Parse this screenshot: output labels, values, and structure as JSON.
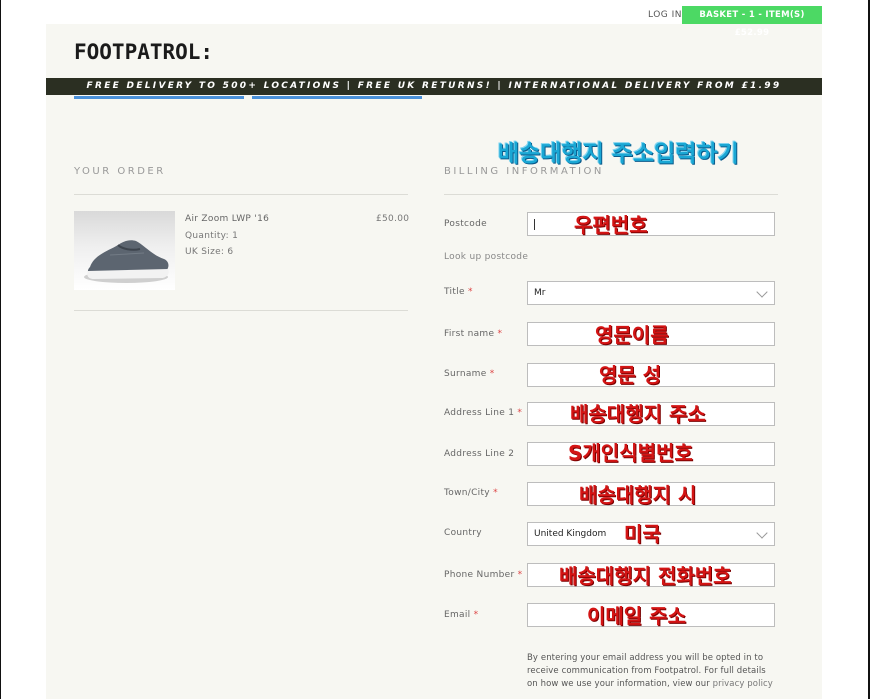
{
  "header": {
    "login_label": "LOG IN",
    "basket_label": "BASKET - 1 - ITEM(S) £52.99",
    "logo_text": "FOOTPATROL:",
    "delivery_banner": "FREE DELIVERY TO 500+ LOCATIONS | FREE UK RETURNS! | INTERNATIONAL DELIVERY FROM £1.99"
  },
  "order": {
    "heading": "YOUR ORDER",
    "product_name": "Air Zoom LWP '16",
    "quantity": "Quantity: 1",
    "size": "UK Size: 6",
    "price": "£50.00"
  },
  "billing": {
    "heading": "BILLING INFORMATION",
    "lookup_label": "Look up postcode",
    "fields": {
      "postcode": {
        "label": "Postcode",
        "required": "",
        "value": ""
      },
      "title": {
        "label": "Title",
        "required": "*",
        "value": "Mr"
      },
      "first_name": {
        "label": "First name",
        "required": "*",
        "value": ""
      },
      "surname": {
        "label": "Surname",
        "required": "*",
        "value": ""
      },
      "address1": {
        "label": "Address Line 1",
        "required": "*",
        "value": ""
      },
      "address2": {
        "label": "Address Line 2",
        "required": "",
        "value": ""
      },
      "town": {
        "label": "Town/City",
        "required": "*",
        "value": ""
      },
      "country": {
        "label": "Country",
        "required": "",
        "value": "United Kingdom"
      },
      "phone": {
        "label": "Phone Number",
        "required": "*",
        "value": ""
      },
      "email": {
        "label": "Email",
        "required": "*",
        "value": ""
      }
    },
    "note_text": "By entering your email address you will be opted in to receive communication from Footpatrol. For full details on how we use your information, view our",
    "note_link": "privacy policy"
  },
  "annotations": {
    "title": "배송대행지 주소입력하기",
    "postcode": "우편번호",
    "first_name": "영문이름",
    "surname": "영문 성",
    "address1": "배송대행지 주소",
    "address2": "S개인식별번호",
    "town": "배송대행지 시",
    "country": "미국",
    "phone": "배송대행지 전화번호",
    "email": "이메일 주소"
  },
  "colors": {
    "basket_green": "#4cd964",
    "banner_dark": "#2b2f22",
    "annotation_red": "#d41414",
    "annotation_blue": "#1aa7d4"
  }
}
